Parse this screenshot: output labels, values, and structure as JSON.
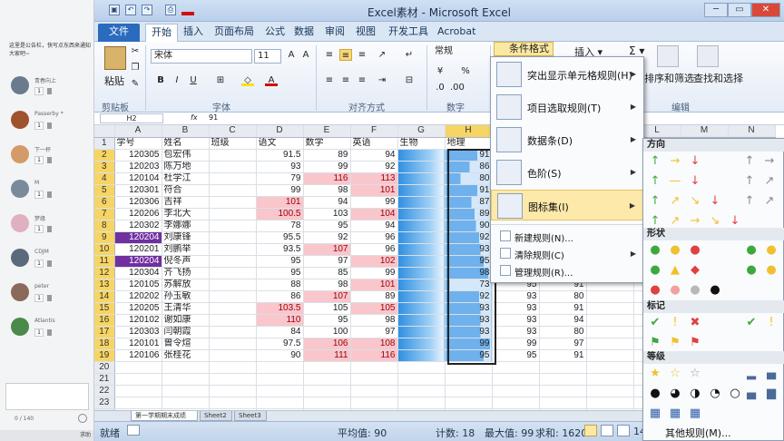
{
  "chat": {
    "notice": "这里是公告栏，快写点东西来通知大家吧~",
    "users": [
      {
        "name": "青春向上"
      },
      {
        "name": "Passerby *"
      },
      {
        "name": "下一杯"
      },
      {
        "name": "M"
      },
      {
        "name": "梦缘"
      },
      {
        "name": "CDJM"
      },
      {
        "name": "peter"
      },
      {
        "name": "Atlantis"
      }
    ],
    "count": "0 / 140",
    "bottom": "求助"
  },
  "window": {
    "title": "Excel素材 - Microsoft Excel"
  },
  "tabs": [
    "文件",
    "开始",
    "插入",
    "页面布局",
    "公式",
    "数据",
    "审阅",
    "视图",
    "开发工具",
    "Acrobat"
  ],
  "ribbon": {
    "paste": "粘贴",
    "clipboard": "剪贴板",
    "font_name": "宋体",
    "font_size": "11",
    "font_group": "字体",
    "align_group": "对齐方式",
    "num_format": "常规",
    "num_group": "数字",
    "cond_format": "条件格式",
    "insert": "插入",
    "sort_filter": "排序和筛选",
    "find_select": "查找和选择",
    "edit_group": "编辑"
  },
  "formula": {
    "cell": "H2",
    "fx": "fx",
    "value": "91"
  },
  "columns": [
    "A",
    "B",
    "C",
    "D",
    "E",
    "F",
    "G",
    "H",
    "I",
    "J",
    "K",
    "L",
    "M",
    "N"
  ],
  "header_row": [
    "学号",
    "姓名",
    "班级",
    "语文",
    "数学",
    "英语",
    "生物",
    "地理"
  ],
  "rows": [
    {
      "r": "2",
      "id": "120305",
      "name": "包宏伟",
      "yw": "91.5",
      "sx": "89",
      "yy": "94",
      "dl": "91"
    },
    {
      "r": "3",
      "id": "120203",
      "name": "陈万地",
      "yw": "93",
      "sx": "99",
      "yy": "92",
      "dl": "86"
    },
    {
      "r": "4",
      "id": "120104",
      "name": "杜学江",
      "yw": "79",
      "sx": "116",
      "yy": "113",
      "dl": "80"
    },
    {
      "r": "5",
      "id": "120301",
      "name": "符合",
      "yw": "99",
      "sx": "98",
      "yy": "101",
      "dl": "91"
    },
    {
      "r": "6",
      "id": "120306",
      "name": "吉祥",
      "yw": "101",
      "sx": "94",
      "yy": "99",
      "dl": "87"
    },
    {
      "r": "7",
      "id": "120206",
      "name": "李北大",
      "yw": "100.5",
      "sx": "103",
      "yy": "104",
      "dl": "89"
    },
    {
      "r": "8",
      "id": "120302",
      "name": "李娜娜",
      "yw": "78",
      "sx": "95",
      "yy": "94",
      "dl": "90"
    },
    {
      "r": "9",
      "id": "120204",
      "name": "刘康锋",
      "yw": "95.5",
      "sx": "92",
      "yy": "96",
      "dl": "92"
    },
    {
      "r": "10",
      "id": "120201",
      "name": "刘鹏举",
      "yw": "93.5",
      "sx": "107",
      "yy": "96",
      "dl": "93"
    },
    {
      "r": "11",
      "id": "120204",
      "name": "倪冬声",
      "yw": "95",
      "sx": "97",
      "yy": "102",
      "dl": "95"
    },
    {
      "r": "12",
      "id": "120304",
      "name": "齐飞扬",
      "yw": "95",
      "sx": "85",
      "yy": "99",
      "dl": "98"
    },
    {
      "r": "13",
      "id": "120105",
      "name": "苏解放",
      "yw": "88",
      "sx": "98",
      "yy": "101",
      "dl": "73"
    },
    {
      "r": "14",
      "id": "120202",
      "name": "孙玉敏",
      "yw": "86",
      "sx": "107",
      "yy": "89",
      "dl": "92"
    },
    {
      "r": "15",
      "id": "120205",
      "name": "王清华",
      "yw": "103.5",
      "sx": "105",
      "yy": "105",
      "dl": "93"
    },
    {
      "r": "16",
      "id": "120102",
      "name": "谢如康",
      "yw": "110",
      "sx": "95",
      "yy": "98",
      "dl": "93"
    },
    {
      "r": "17",
      "id": "120303",
      "name": "闫朝霞",
      "yw": "84",
      "sx": "100",
      "yy": "97",
      "dl": "93"
    },
    {
      "r": "18",
      "id": "120101",
      "name": "曾令煊",
      "yw": "97.5",
      "sx": "106",
      "yy": "108",
      "dl": "99"
    },
    {
      "r": "19",
      "id": "120106",
      "name": "张桂花",
      "yw": "90",
      "sx": "111",
      "yy": "116",
      "dl": "95"
    }
  ],
  "extra": {
    "row12": [
      "95",
      "90"
    ],
    "row13": [
      "95",
      "91"
    ],
    "row14": [
      "93",
      "80"
    ],
    "row15": [
      "93",
      "91"
    ],
    "row16": [
      "93",
      "94"
    ],
    "row17": [
      "93",
      "80"
    ],
    "row18": [
      "99",
      "97"
    ],
    "row19": [
      "95",
      "91"
    ]
  },
  "sheets": [
    "第一学期期末成绩",
    "Sheet2",
    "Sheet3"
  ],
  "status": {
    "ready": "就绪",
    "avg": "平均值: 90",
    "count": "计数: 18",
    "max": "最大值: 99",
    "sum": "求和: 1620",
    "zoom": "14"
  },
  "menu": {
    "items": [
      "突出显示单元格规则(H)",
      "项目选取规则(T)",
      "数据条(D)",
      "色阶(S)",
      "图标集(I)"
    ],
    "small": [
      "新建规则(N)...",
      "清除规则(C)",
      "管理规则(R)..."
    ]
  },
  "submenu": {
    "sections": [
      "方向",
      "形状",
      "标记",
      "等级"
    ],
    "more": "其他规则(M)..."
  },
  "colors": {
    "green": "#3ea83e",
    "yellow": "#f0c030",
    "red": "#e04040",
    "grey": "#8a8a8a"
  }
}
